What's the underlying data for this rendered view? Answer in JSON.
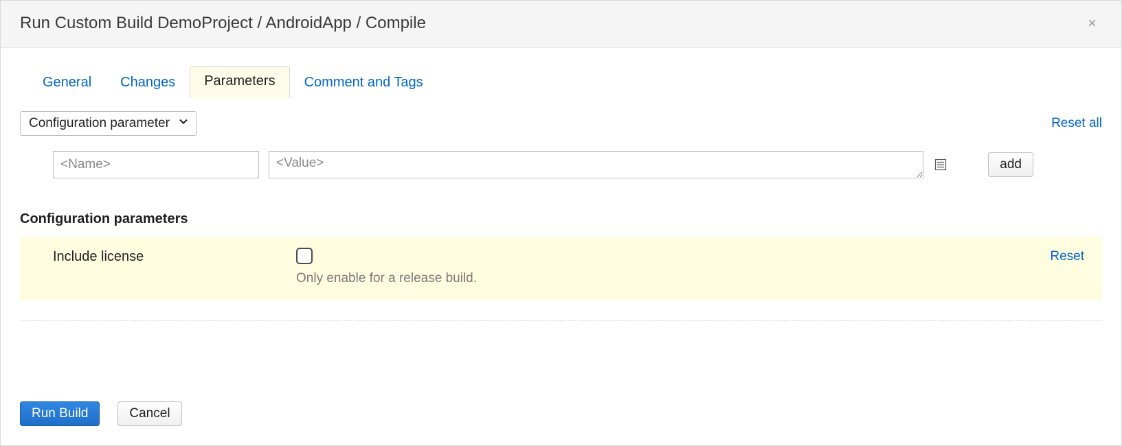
{
  "header": {
    "title": "Run Custom Build DemoProject / AndroidApp / Compile"
  },
  "tabs": {
    "general": "General",
    "changes": "Changes",
    "parameters": "Parameters",
    "comment": "Comment and Tags",
    "active": "parameters"
  },
  "paramType": {
    "selected": "Configuration parameter"
  },
  "links": {
    "resetAll": "Reset all"
  },
  "newParam": {
    "namePlaceholder": "<Name>",
    "valuePlaceholder": "<Value>",
    "addLabel": "add"
  },
  "section": {
    "heading": "Configuration parameters"
  },
  "params": [
    {
      "label": "Include license",
      "checked": false,
      "description": "Only enable for a release build.",
      "resetLabel": "Reset"
    }
  ],
  "footer": {
    "run": "Run Build",
    "cancel": "Cancel"
  }
}
